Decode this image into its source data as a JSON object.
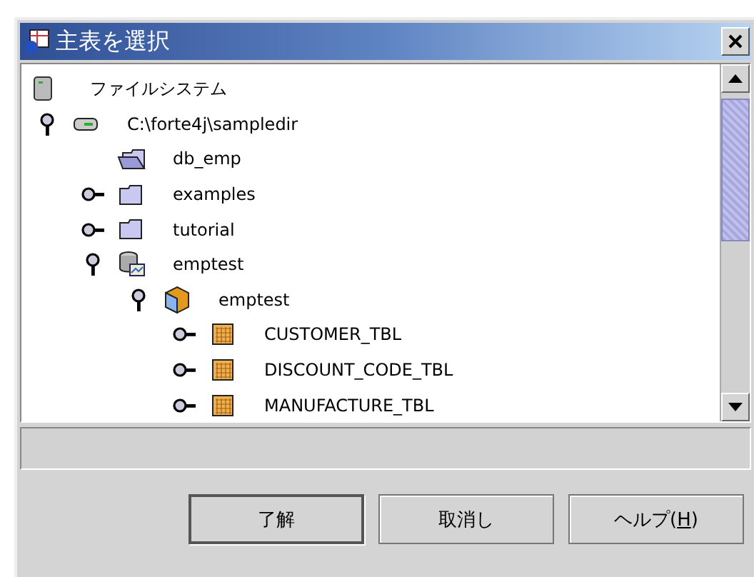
{
  "window": {
    "title": "主表を選択"
  },
  "tree": [
    {
      "label": "ファイルシステム",
      "kind": "filesystem",
      "children": [
        {
          "label": "C:\\forte4j\\sampledir",
          "kind": "drive",
          "expanded": true,
          "children": [
            {
              "label": "db_emp",
              "kind": "folder-open"
            },
            {
              "label": "examples",
              "kind": "folder",
              "expanded": false
            },
            {
              "label": "tutorial",
              "kind": "folder",
              "expanded": false
            },
            {
              "label": "emptest",
              "kind": "database",
              "expanded": true,
              "children": [
                {
                  "label": "emptest",
                  "kind": "schema",
                  "expanded": true,
                  "children": [
                    {
                      "label": "CUSTOMER_TBL",
                      "kind": "table",
                      "expanded": false
                    },
                    {
                      "label": "DISCOUNT_CODE_TBL",
                      "kind": "table",
                      "expanded": false
                    },
                    {
                      "label": "MANUFACTURE_TBL",
                      "kind": "table",
                      "expanded": false
                    }
                  ]
                }
              ]
            }
          ]
        }
      ]
    }
  ],
  "buttons": [
    {
      "label": "了解",
      "default": true
    },
    {
      "label": "取消し",
      "default": false
    },
    {
      "label_before": "ヘルプ(",
      "mnemonic": "H",
      "label_after": ")",
      "default": false
    }
  ]
}
